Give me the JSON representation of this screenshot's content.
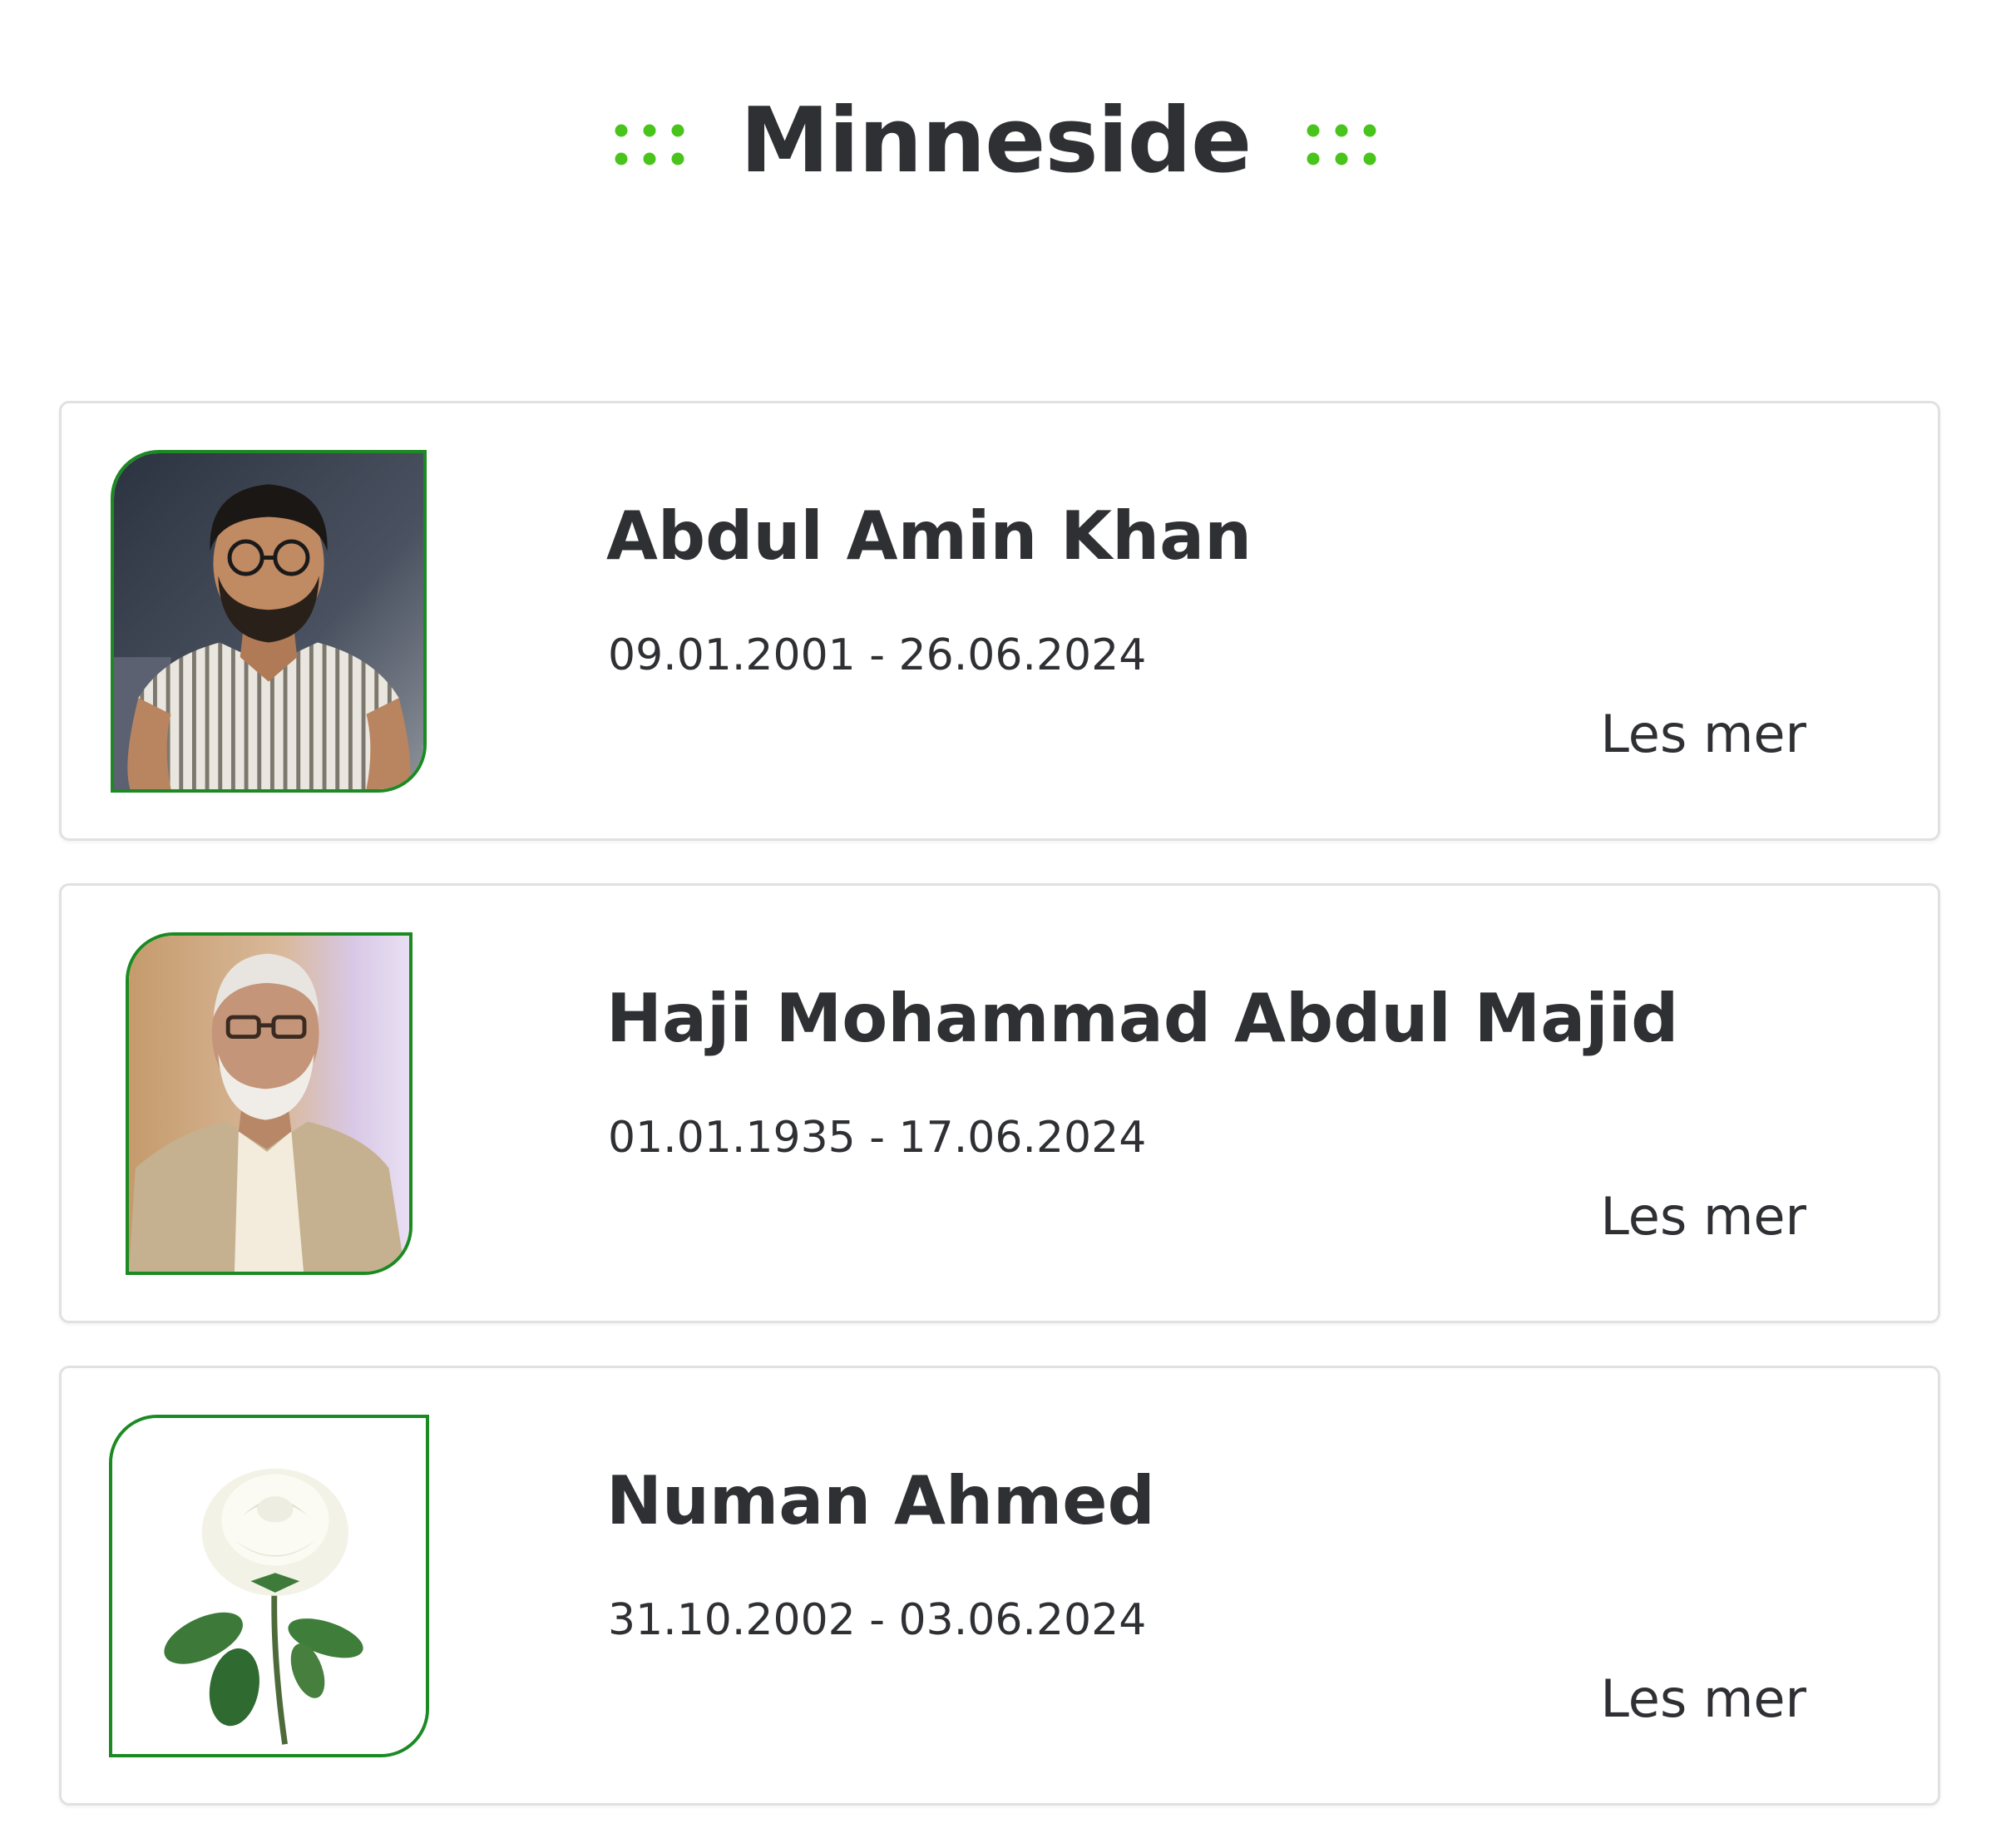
{
  "header": {
    "title": "Minneside",
    "left_icon": "dots-grid-icon",
    "right_icon": "dots-grid-icon"
  },
  "colors": {
    "accent_green": "#49c41c",
    "frame_green": "#1c8a22",
    "text": "#2f3033",
    "card_border": "#e1e1e1"
  },
  "memorials": [
    {
      "name": "Abdul Amin Khan",
      "dates": "09.01.2001 - 26.06.2024",
      "read_more": "Les mer",
      "photo": "portrait-young-man-photo"
    },
    {
      "name": "Haji Mohammad Abdul Majid",
      "dates": "01.01.1935 - 17.06.2024",
      "read_more": "Les mer",
      "photo": "portrait-elderly-man-photo"
    },
    {
      "name": "Numan Ahmed",
      "dates": "31.10.2002 - 03.06.2024",
      "read_more": "Les mer",
      "photo": "white-rose-image"
    }
  ]
}
